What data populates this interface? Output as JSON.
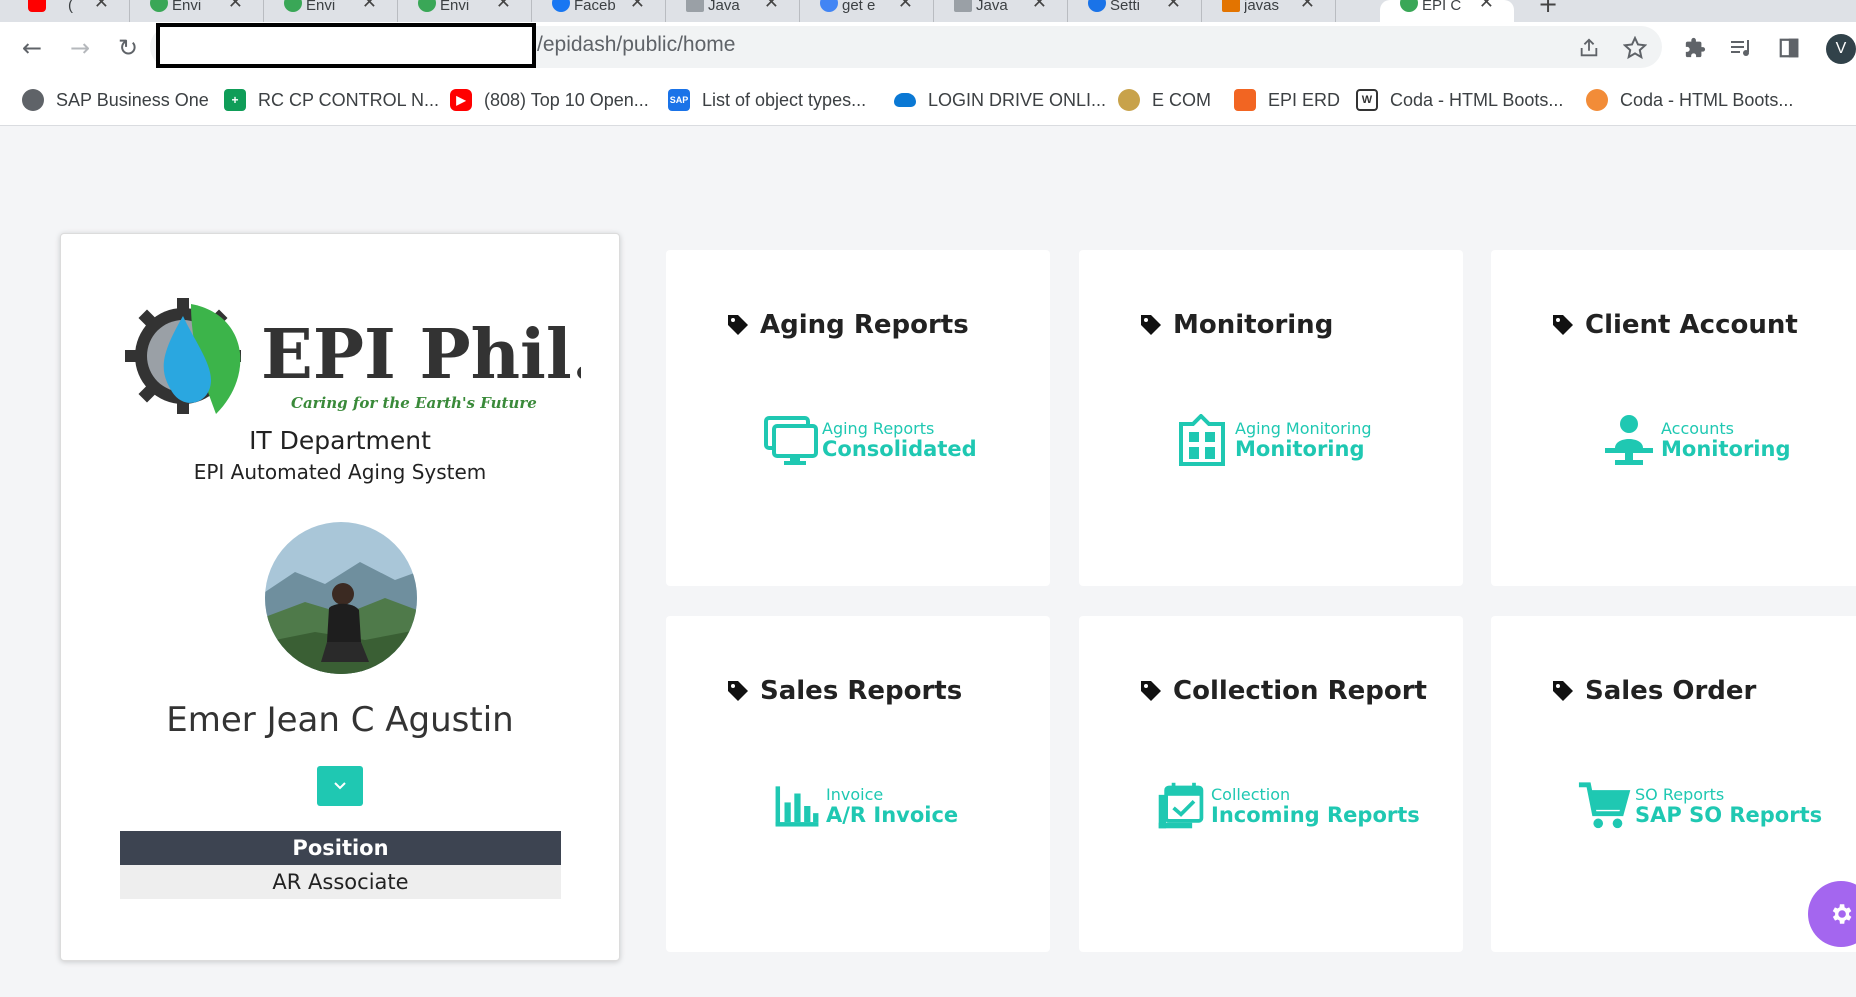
{
  "browser": {
    "tabs": [
      {
        "title": "(",
        "favicon_color": "#ff0000"
      },
      {
        "title": "Envi",
        "favicon_color": "#3aa757"
      },
      {
        "title": "Envi",
        "favicon_color": "#3aa757"
      },
      {
        "title": "Envi",
        "favicon_color": "#3aa757"
      },
      {
        "title": "Faceb",
        "favicon_color": "#1877f2"
      },
      {
        "title": "Java",
        "favicon_color": "#9aa0a6"
      },
      {
        "title": "get e",
        "favicon_color": "#4285f4"
      },
      {
        "title": "Java",
        "favicon_color": "#9aa0a6"
      },
      {
        "title": "Setti",
        "favicon_color": "#1a73e8"
      },
      {
        "title": "javas",
        "favicon_color": "#e37400"
      },
      {
        "title": "EPI C",
        "favicon_color": "#3aa757"
      }
    ],
    "url": "/epidash/public/home",
    "profile_initial": "V",
    "bookmarks": [
      {
        "label": "SAP Business One",
        "icon": "globe-icon",
        "color": "#5f6368"
      },
      {
        "label": "RC CP CONTROL N...",
        "icon": "sheets-icon",
        "color": "#0f9d58"
      },
      {
        "label": "(808) Top 10 Open...",
        "icon": "youtube-icon",
        "color": "#ff0000"
      },
      {
        "label": "List of object types...",
        "icon": "sap-icon",
        "color": "#1a73e8"
      },
      {
        "label": "LOGIN DRIVE ONLI...",
        "icon": "onedrive-icon",
        "color": "#0a78d4"
      },
      {
        "label": "E COM",
        "icon": "leaf-icon",
        "color": "#c8a24a"
      },
      {
        "label": "EPI ERD",
        "icon": "erd-icon",
        "color": "#f26522"
      },
      {
        "label": "Coda - HTML Boots...",
        "icon": "coda-w-icon",
        "color": "#333333"
      },
      {
        "label": "Coda - HTML Boots...",
        "icon": "coda-orange-icon",
        "color": "#f28c38"
      }
    ]
  },
  "profile": {
    "logo_text": "EPI Phil.",
    "logo_tagline": "Caring for the Earth's Future",
    "department": "IT Department",
    "system": "EPI Automated Aging System",
    "name": "Emer Jean C Agustin",
    "position_header": "Position",
    "position_value": "AR Associate"
  },
  "cards": [
    {
      "title": "Aging Reports",
      "small": "Aging Reports",
      "big": "Consolidated",
      "icon": "monitor-icon"
    },
    {
      "title": "Monitoring",
      "small": "Aging Monitoring",
      "big": "Monitoring",
      "icon": "building-icon"
    },
    {
      "title": "Client Account",
      "small": "Accounts",
      "big": "Monitoring",
      "icon": "user-desk-icon"
    },
    {
      "title": "Sales Reports",
      "small": "Invoice",
      "big": "A/R Invoice",
      "icon": "bar-chart-icon"
    },
    {
      "title": "Collection Report",
      "small": "Collection",
      "big": "Incoming Reports",
      "icon": "calendar-check-icon"
    },
    {
      "title": "Sales Order",
      "small": "SO Reports",
      "big": "SAP SO Reports",
      "icon": "cart-icon"
    }
  ],
  "colors": {
    "accent": "#1fc8b2",
    "header_dark": "#3d4451",
    "fab": "#a466ef"
  }
}
